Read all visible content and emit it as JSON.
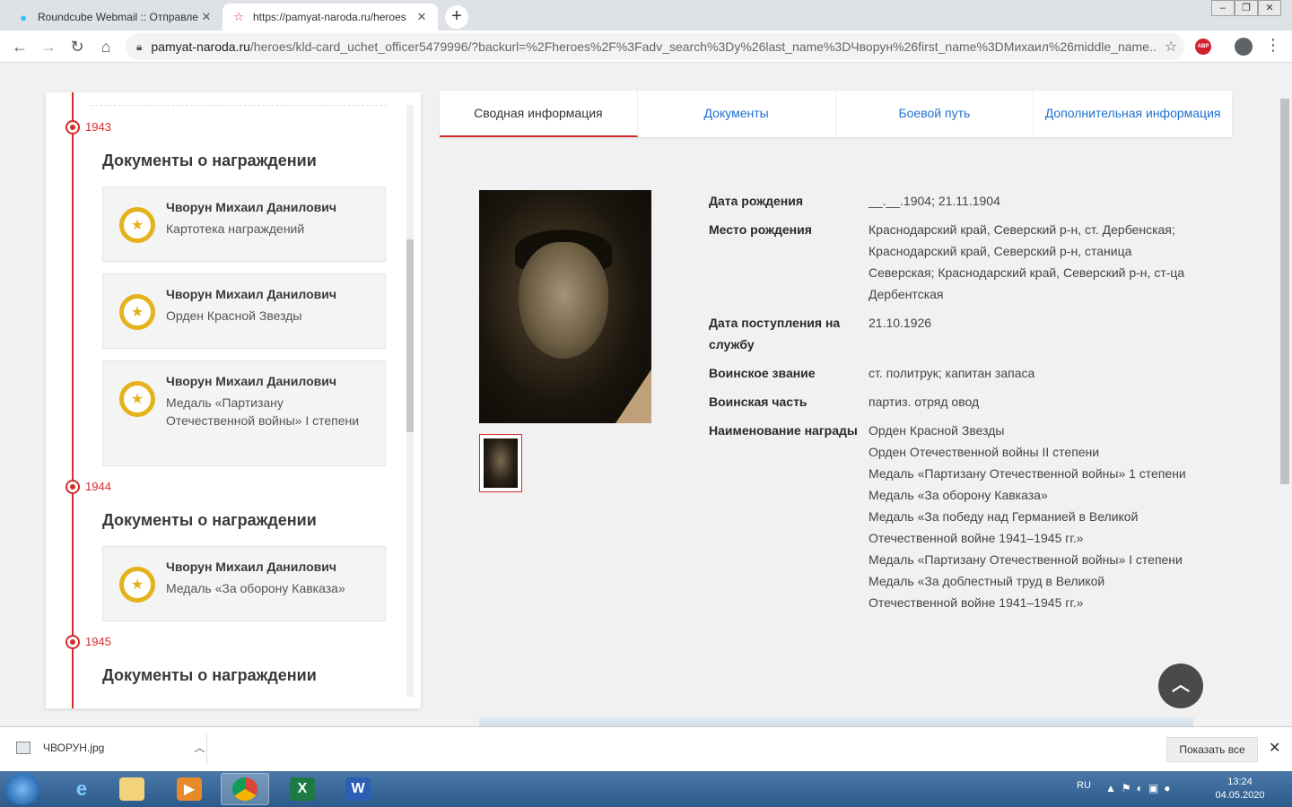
{
  "browser": {
    "tabs": [
      {
        "title": "Roundcube Webmail :: Отправле",
        "icon": "roundcube-icon"
      },
      {
        "title": "https://pamyat-naroda.ru/heroes",
        "icon": "star-icon"
      }
    ],
    "new_tab": "+",
    "url_domain": "pamyat-naroda.ru",
    "url_path": "/heroes/kld-card_uchet_officer5479996/?backurl=%2Fheroes%2F%3Fadv_search%3Dy%26last_name%3DЧворун%26first_name%3DМихаил%26middle_name...",
    "abp_label": "ABP"
  },
  "sidebar": {
    "groups": [
      {
        "year": "1943",
        "title": "Документы о награждении",
        "items": [
          {
            "name": "Чворун Михаил Данилович",
            "what": "Картотека награждений"
          },
          {
            "name": "Чворун Михаил Данилович",
            "what": "Орден Красной Звезды"
          },
          {
            "name": "Чворун Михаил Данилович",
            "what": "Медаль «Партизану Отечественной войны» I степени"
          }
        ]
      },
      {
        "year": "1944",
        "title": "Документы о награждении",
        "items": [
          {
            "name": "Чворун Михаил Данилович",
            "what": "Медаль «За оборону Кавказа»"
          }
        ]
      },
      {
        "year": "1945",
        "title": "Документы о награждении",
        "items": []
      }
    ]
  },
  "tabs": [
    {
      "label": "Сводная информация",
      "active": true
    },
    {
      "label": "Документы",
      "active": false
    },
    {
      "label": "Боевой путь",
      "active": false
    },
    {
      "label": "Дополнительная информация",
      "active": false
    }
  ],
  "info": {
    "birth_date_label": "Дата рождения",
    "birth_date": "__.__.1904; 21.11.1904",
    "birth_place_label": "Место рождения",
    "birth_place": "Краснодарский край, Северский р-н, ст. Дербенская; Краснодарский край, Северский р-н, станица Северская; Краснодарский край, Северский р-н, ст-ца Дербентская",
    "service_start_label": "Дата поступления на службу",
    "service_start": "21.10.1926",
    "rank_label": "Воинское звание",
    "rank": "ст. политрук; капитан запаса",
    "unit_label": "Воинская часть",
    "unit": "партиз. отряд овод",
    "awards_label": "Наименование награды",
    "awards": [
      "Орден Красной Звезды",
      "Орден Отечественной войны II степени",
      "Медаль «Партизану Отечественной войны» 1 степени",
      "Медаль «За оборону Кавказа»",
      "Медаль «За победу над Германией в Великой Отечественной войне 1941–1945 гг.»",
      "Медаль «Партизану Отечественной войны» I степени",
      "Медаль «За доблестный труд в Великой Отечественной войне 1941–1945 гг.»"
    ]
  },
  "downloads": {
    "file": "ЧВОРУН.jpg",
    "show_all": "Показать все"
  },
  "taskbar": {
    "lang": "RU",
    "time": "13:24",
    "date": "04.05.2020"
  },
  "colors": {
    "accent_red": "#d62b2b",
    "link_blue": "#1f6fd1",
    "medal_gold": "#e5b21c"
  }
}
